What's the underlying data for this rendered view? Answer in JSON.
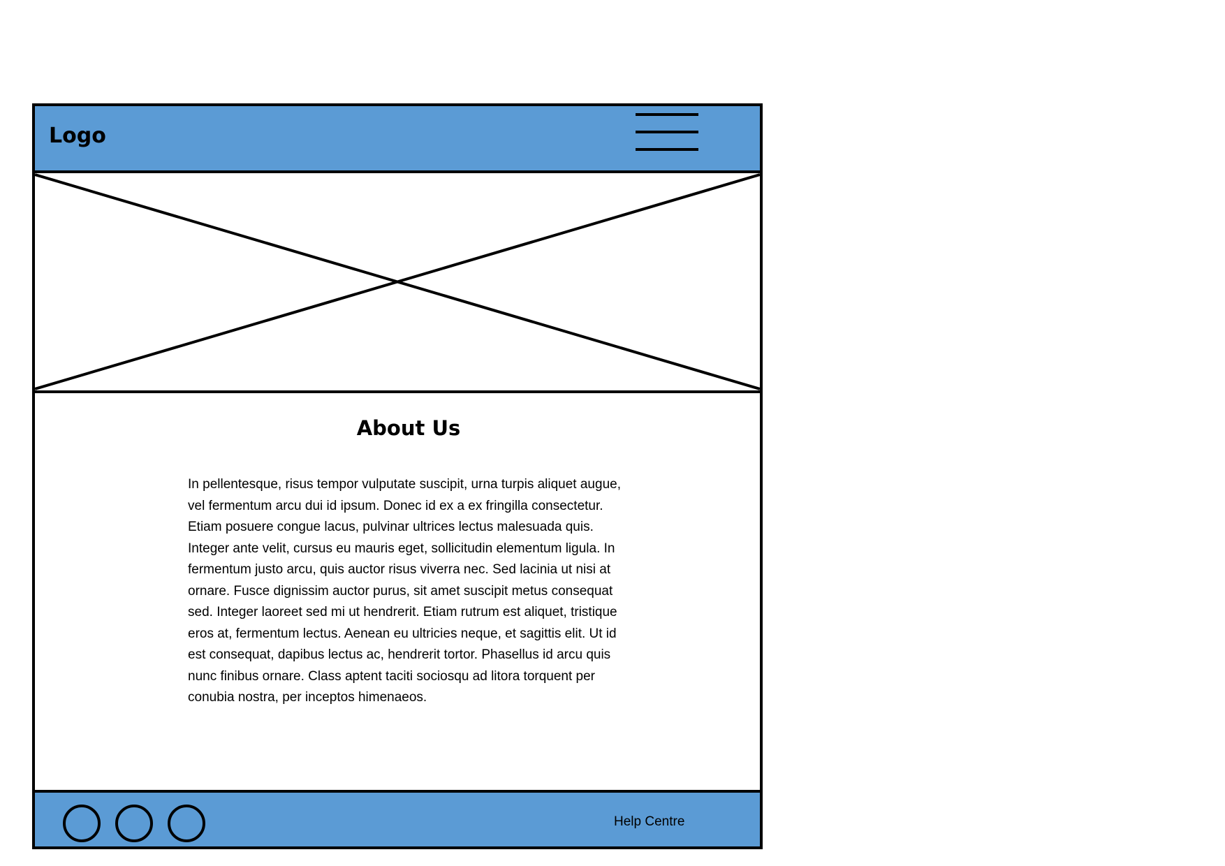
{
  "header": {
    "logo": "Logo",
    "menu_icon": "hamburger-menu-icon"
  },
  "hero": {
    "image_placeholder_icon": "image-placeholder-icon"
  },
  "about": {
    "title": "About Us",
    "body": "In pellentesque, risus tempor vulputate suscipit, urna turpis aliquet augue, vel fermentum arcu dui id ipsum. Donec id ex a ex fringilla consectetur. Etiam posuere congue lacus, pulvinar ultrices lectus malesuada quis. Integer ante velit, cursus eu mauris eget, sollicitudin elementum ligula. In fermentum justo arcu, quis auctor risus viverra nec. Sed lacinia ut nisi at ornare. Fusce dignissim auctor purus, sit amet suscipit metus consequat sed. Integer laoreet sed mi ut hendrerit. Etiam rutrum est aliquet, tristique eros at, fermentum lectus. Aenean eu ultricies neque, et sagittis elit. Ut id est consequat, dapibus lectus ac, hendrerit tortor. Phasellus id arcu quis nunc finibus ornare. Class aptent taciti sociosqu ad litora torquent per conubia nostra, per inceptos himenaeos."
  },
  "footer": {
    "social_icons": [
      "circle-icon",
      "circle-icon",
      "circle-icon"
    ],
    "help_link": "Help Centre"
  },
  "colors": {
    "accent": "#5b9bd5",
    "outline": "#000000",
    "background": "#ffffff"
  }
}
